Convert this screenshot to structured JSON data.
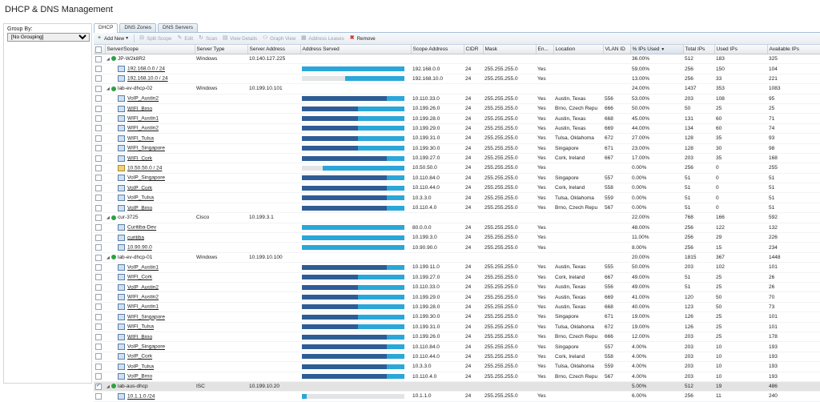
{
  "app": {
    "title": "DHCP & DNS Management"
  },
  "group_by": {
    "label": "Group By:",
    "value": "[No Grouping]"
  },
  "tabs": [
    "DHCP",
    "DNS Zones",
    "DNS Servers"
  ],
  "toolbar": {
    "add_new": "Add New",
    "split_scope": "Split Scope",
    "edit": "Edit",
    "scan": "Scan",
    "view_details": "View Details",
    "graph_view": "Graph View",
    "address_leases": "Address Leases",
    "remove": "Remove"
  },
  "columns": [
    "Server/Scope",
    "Server Type",
    "Server Address",
    "Address Served",
    "Scope Address",
    "CIDR",
    "Mask",
    "En...",
    "Location",
    "VLAN ID",
    "% IPs Used",
    "Total IPs",
    "Used IPs",
    "Available IPs"
  ],
  "colors": {
    "used": "#2e5d95",
    "free": "#2aa7d8",
    "empty": "#e3e4e6",
    "status_ok": "#2ea043"
  },
  "rows": [
    {
      "kind": "server",
      "name": "JP-W2k8R2",
      "type": "Windows",
      "addr": "10.140.127.225",
      "pct": "36.00%",
      "total": "512",
      "used": "183",
      "avail": "325"
    },
    {
      "kind": "scope",
      "name": "192.168.0.0 / 24",
      "bar_used": 0,
      "bar_free": 1,
      "bar_start": 0,
      "scope": "192.168.0.0",
      "cidr": "24",
      "mask": "255.255.255.0",
      "en": "Yes",
      "loc": "",
      "vlan": "",
      "pct": "59.00%",
      "total": "256",
      "used": "150",
      "avail": "104"
    },
    {
      "kind": "scope",
      "name": "192.168.10.0 / 24",
      "bar_used": 0,
      "bar_free": 0.58,
      "bar_start": 0.42,
      "scope": "192.168.10.0",
      "cidr": "24",
      "mask": "255.255.255.0",
      "en": "Yes",
      "loc": "",
      "vlan": "",
      "pct": "13.00%",
      "total": "256",
      "used": "33",
      "avail": "221"
    },
    {
      "kind": "server",
      "name": "lab-ev-dhcp-02",
      "type": "Windows",
      "addr": "10.199.10.101",
      "pct": "24.00%",
      "total": "1437",
      "used": "353",
      "avail": "1083"
    },
    {
      "kind": "scope",
      "name": "VoIP_Austin2",
      "bar_used": 0.83,
      "bar_free": 0.17,
      "bar_start": 0,
      "scope": "10.110.33.0",
      "cidr": "24",
      "mask": "255.255.255.0",
      "en": "Yes",
      "loc": "Austin, Texas",
      "vlan": "556",
      "pct": "53.00%",
      "total": "203",
      "used": "108",
      "avail": "95"
    },
    {
      "kind": "scope",
      "name": "WIFI_Brno",
      "bar_used": 0.55,
      "bar_free": 0.45,
      "bar_start": 0,
      "scope": "10.199.26.0",
      "cidr": "24",
      "mask": "255.255.255.0",
      "en": "Yes",
      "loc": "Brno, Czech Repu",
      "vlan": "666",
      "pct": "50.00%",
      "total": "50",
      "used": "25",
      "avail": "25"
    },
    {
      "kind": "scope",
      "name": "WIFI_Austin1",
      "bar_used": 0.55,
      "bar_free": 0.45,
      "bar_start": 0,
      "scope": "10.199.28.0",
      "cidr": "24",
      "mask": "255.255.255.0",
      "en": "Yes",
      "loc": "Austin, Texas",
      "vlan": "668",
      "pct": "45.00%",
      "total": "131",
      "used": "60",
      "avail": "71"
    },
    {
      "kind": "scope",
      "name": "WIFI_Austin2",
      "bar_used": 0.55,
      "bar_free": 0.45,
      "bar_start": 0,
      "scope": "10.199.29.0",
      "cidr": "24",
      "mask": "255.255.255.0",
      "en": "Yes",
      "loc": "Austin, Texas",
      "vlan": "669",
      "pct": "44.00%",
      "total": "134",
      "used": "60",
      "avail": "74"
    },
    {
      "kind": "scope",
      "name": "WIFI_Tulsa",
      "bar_used": 0.55,
      "bar_free": 0.45,
      "bar_start": 0,
      "scope": "10.199.31.0",
      "cidr": "24",
      "mask": "255.255.255.0",
      "en": "Yes",
      "loc": "Tulsa, Oklahoma",
      "vlan": "672",
      "pct": "27.00%",
      "total": "128",
      "used": "35",
      "avail": "93"
    },
    {
      "kind": "scope",
      "name": "WIFI_Singapore",
      "bar_used": 0.55,
      "bar_free": 0.45,
      "bar_start": 0,
      "scope": "10.199.30.0",
      "cidr": "24",
      "mask": "255.255.255.0",
      "en": "Yes",
      "loc": "Singapore",
      "vlan": "671",
      "pct": "23.00%",
      "total": "128",
      "used": "30",
      "avail": "98"
    },
    {
      "kind": "scope",
      "name": "WIFI_Cork",
      "bar_used": 0.83,
      "bar_free": 0.17,
      "bar_start": 0,
      "scope": "10.199.27.0",
      "cidr": "24",
      "mask": "255.255.255.0",
      "en": "Yes",
      "loc": "Cork, Ireland",
      "vlan": "667",
      "pct": "17.00%",
      "total": "203",
      "used": "35",
      "avail": "168"
    },
    {
      "kind": "scope",
      "alert": true,
      "name": "10.50.50.0 / 24",
      "bar_used": 0,
      "bar_free": 0.8,
      "bar_start": 0.2,
      "scope": "10.50.50.0",
      "cidr": "24",
      "mask": "255.255.255.0",
      "en": "Yes",
      "loc": "",
      "vlan": "",
      "pct": "0.00%",
      "total": "256",
      "used": "0",
      "avail": "255"
    },
    {
      "kind": "scope",
      "name": "VoIP_Singapore",
      "bar_used": 0.83,
      "bar_free": 0.17,
      "bar_start": 0,
      "scope": "10.110.84.0",
      "cidr": "24",
      "mask": "255.255.255.0",
      "en": "Yes",
      "loc": "Singapore",
      "vlan": "557",
      "pct": "0.00%",
      "total": "51",
      "used": "0",
      "avail": "51"
    },
    {
      "kind": "scope",
      "name": "VoIP_Cork",
      "bar_used": 0.83,
      "bar_free": 0.17,
      "bar_start": 0,
      "scope": "10.110.44.0",
      "cidr": "24",
      "mask": "255.255.255.0",
      "en": "Yes",
      "loc": "Cork, Ireland",
      "vlan": "558",
      "pct": "0.00%",
      "total": "51",
      "used": "0",
      "avail": "51"
    },
    {
      "kind": "scope",
      "name": "VoIP_Tulsa",
      "bar_used": 0.83,
      "bar_free": 0.17,
      "bar_start": 0,
      "scope": "10.3.3.0",
      "cidr": "24",
      "mask": "255.255.255.0",
      "en": "Yes",
      "loc": "Tulsa, Oklahoma",
      "vlan": "559",
      "pct": "0.00%",
      "total": "51",
      "used": "0",
      "avail": "51"
    },
    {
      "kind": "scope",
      "name": "VoIP_Brno",
      "bar_used": 0.83,
      "bar_free": 0.17,
      "bar_start": 0,
      "scope": "10.110.4.0",
      "cidr": "24",
      "mask": "255.255.255.0",
      "en": "Yes",
      "loc": "Brno, Czech Repu",
      "vlan": "567",
      "pct": "0.00%",
      "total": "51",
      "used": "0",
      "avail": "51"
    },
    {
      "kind": "server",
      "name": "cur-3725",
      "type": "Cisco",
      "addr": "10.199.3.1",
      "pct": "22.00%",
      "total": "768",
      "used": "166",
      "avail": "592"
    },
    {
      "kind": "scope",
      "name": "Curitiba-Dev",
      "bar_used": 0,
      "bar_free": 1,
      "bar_start": 0,
      "scope": "80.0.0.0",
      "cidr": "24",
      "mask": "255.255.255.0",
      "en": "Yes",
      "loc": "",
      "vlan": "",
      "pct": "48.00%",
      "total": "256",
      "used": "122",
      "avail": "132"
    },
    {
      "kind": "scope",
      "name": "curitiba",
      "bar_used": 0,
      "bar_free": 1,
      "bar_start": 0,
      "scope": "10.199.3.0",
      "cidr": "24",
      "mask": "255.255.255.0",
      "en": "Yes",
      "loc": "",
      "vlan": "",
      "pct": "11.00%",
      "total": "256",
      "used": "29",
      "avail": "226"
    },
    {
      "kind": "scope",
      "name": "10.90.90.0",
      "bar_used": 0,
      "bar_free": 1,
      "bar_start": 0,
      "scope": "10.90.90.0",
      "cidr": "24",
      "mask": "255.255.255.0",
      "en": "Yes",
      "loc": "",
      "vlan": "",
      "pct": "8.00%",
      "total": "256",
      "used": "15",
      "avail": "234"
    },
    {
      "kind": "server",
      "name": "lab-ev-dhcp-01",
      "type": "Windows",
      "addr": "10.199.10.100",
      "pct": "20.00%",
      "total": "1815",
      "used": "367",
      "avail": "1448"
    },
    {
      "kind": "scope",
      "name": "VoIP_Austin1",
      "bar_used": 0.83,
      "bar_free": 0.17,
      "bar_start": 0,
      "scope": "10.199.11.0",
      "cidr": "24",
      "mask": "255.255.255.0",
      "en": "Yes",
      "loc": "Austin, Texas",
      "vlan": "555",
      "pct": "50.00%",
      "total": "203",
      "used": "102",
      "avail": "101"
    },
    {
      "kind": "scope",
      "name": "WIFI_Cork",
      "bar_used": 0.55,
      "bar_free": 0.45,
      "bar_start": 0,
      "scope": "10.199.27.0",
      "cidr": "24",
      "mask": "255.255.255.0",
      "en": "Yes",
      "loc": "Cork, Ireland",
      "vlan": "667",
      "pct": "49.00%",
      "total": "51",
      "used": "25",
      "avail": "26"
    },
    {
      "kind": "scope",
      "name": "VoIP_Austin2",
      "bar_used": 0.55,
      "bar_free": 0.45,
      "bar_start": 0,
      "scope": "10.110.33.0",
      "cidr": "24",
      "mask": "255.255.255.0",
      "en": "Yes",
      "loc": "Austin, Texas",
      "vlan": "556",
      "pct": "49.00%",
      "total": "51",
      "used": "25",
      "avail": "26"
    },
    {
      "kind": "scope",
      "name": "WIFI_Austin2",
      "bar_used": 0.55,
      "bar_free": 0.45,
      "bar_start": 0,
      "scope": "10.199.29.0",
      "cidr": "24",
      "mask": "255.255.255.0",
      "en": "Yes",
      "loc": "Austin, Texas",
      "vlan": "669",
      "pct": "41.00%",
      "total": "120",
      "used": "50",
      "avail": "70"
    },
    {
      "kind": "scope",
      "name": "WIFI_Austin1",
      "bar_used": 0.55,
      "bar_free": 0.45,
      "bar_start": 0,
      "scope": "10.199.28.0",
      "cidr": "24",
      "mask": "255.255.255.0",
      "en": "Yes",
      "loc": "Austin, Texas",
      "vlan": "668",
      "pct": "40.00%",
      "total": "123",
      "used": "50",
      "avail": "73"
    },
    {
      "kind": "scope",
      "name": "WIFI_Singapore",
      "bar_used": 0.55,
      "bar_free": 0.45,
      "bar_start": 0,
      "scope": "10.199.30.0",
      "cidr": "24",
      "mask": "255.255.255.0",
      "en": "Yes",
      "loc": "Singapore",
      "vlan": "671",
      "pct": "19.00%",
      "total": "126",
      "used": "25",
      "avail": "101"
    },
    {
      "kind": "scope",
      "name": "WIFI_Tulsa",
      "bar_used": 0.55,
      "bar_free": 0.45,
      "bar_start": 0,
      "scope": "10.199.31.0",
      "cidr": "24",
      "mask": "255.255.255.0",
      "en": "Yes",
      "loc": "Tulsa, Oklahoma",
      "vlan": "672",
      "pct": "19.00%",
      "total": "126",
      "used": "25",
      "avail": "101"
    },
    {
      "kind": "scope",
      "name": "WIFI_Brno",
      "bar_used": 0.83,
      "bar_free": 0.17,
      "bar_start": 0,
      "scope": "10.199.26.0",
      "cidr": "24",
      "mask": "255.255.255.0",
      "en": "Yes",
      "loc": "Brno, Czech Repu",
      "vlan": "666",
      "pct": "12.00%",
      "total": "203",
      "used": "25",
      "avail": "178"
    },
    {
      "kind": "scope",
      "name": "VoIP_Singapore",
      "bar_used": 0.83,
      "bar_free": 0.17,
      "bar_start": 0,
      "scope": "10.110.84.0",
      "cidr": "24",
      "mask": "255.255.255.0",
      "en": "Yes",
      "loc": "Singapore",
      "vlan": "557",
      "pct": "4.00%",
      "total": "203",
      "used": "10",
      "avail": "193"
    },
    {
      "kind": "scope",
      "name": "VoIP_Cork",
      "bar_used": 0.83,
      "bar_free": 0.17,
      "bar_start": 0,
      "scope": "10.110.44.0",
      "cidr": "24",
      "mask": "255.255.255.0",
      "en": "Yes",
      "loc": "Cork, Ireland",
      "vlan": "558",
      "pct": "4.00%",
      "total": "203",
      "used": "10",
      "avail": "193"
    },
    {
      "kind": "scope",
      "name": "VoIP_Tulsa",
      "bar_used": 0.83,
      "bar_free": 0.17,
      "bar_start": 0,
      "scope": "10.3.3.0",
      "cidr": "24",
      "mask": "255.255.255.0",
      "en": "Yes",
      "loc": "Tulsa, Oklahoma",
      "vlan": "559",
      "pct": "4.00%",
      "total": "203",
      "used": "10",
      "avail": "193"
    },
    {
      "kind": "scope",
      "name": "VoIP_Brno",
      "bar_used": 0.83,
      "bar_free": 0.17,
      "bar_start": 0,
      "scope": "10.110.4.0",
      "cidr": "24",
      "mask": "255.255.255.0",
      "en": "Yes",
      "loc": "Brno, Czech Repu",
      "vlan": "567",
      "pct": "4.00%",
      "total": "203",
      "used": "10",
      "avail": "193"
    },
    {
      "kind": "server",
      "selected": true,
      "name": "lab-aus-dhcp",
      "type": "ISC",
      "addr": "10.199.10.20",
      "pct": "5.00%",
      "total": "512",
      "used": "19",
      "avail": "486"
    },
    {
      "kind": "scope",
      "name": "10.1.1.0 /24",
      "bar_used": 0,
      "bar_free": 0.05,
      "bar_start": 0,
      "scope": "10.1.1.0",
      "cidr": "24",
      "mask": "255.255.255.0",
      "en": "Yes",
      "loc": "",
      "vlan": "",
      "pct": "6.00%",
      "total": "256",
      "used": "11",
      "avail": "240"
    }
  ]
}
